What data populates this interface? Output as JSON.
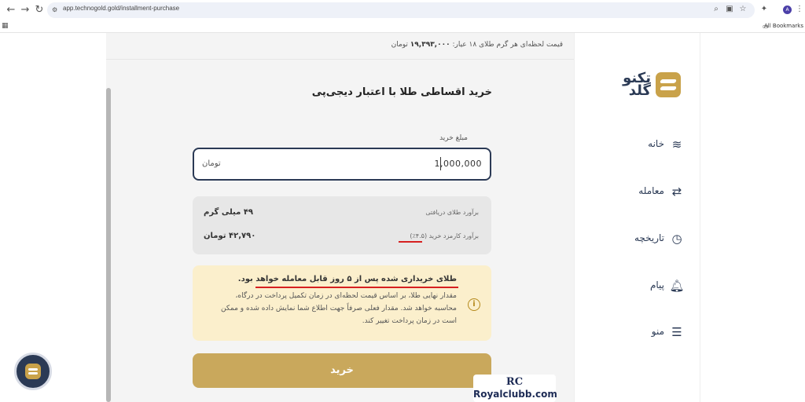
{
  "browser": {
    "url": "app.technogold.gold/installment-purchase",
    "bookmarks_label": "All Bookmarks",
    "profile_initial": "A"
  },
  "header": {
    "price_label": "قیمت لحظه‌ای هر گرم طلای ۱۸ عیار:",
    "price_value": "۱۹,۳۹۳,۰۰۰",
    "price_unit": "تومان"
  },
  "brand": {
    "logo_line1": "تکنو",
    "logo_line2": "گلد"
  },
  "sidebar": {
    "items": [
      {
        "label": "خانه",
        "icon": "home-icon"
      },
      {
        "label": "معامله",
        "icon": "trade-icon"
      },
      {
        "label": "تاریخچه",
        "icon": "history-icon"
      },
      {
        "label": "پیام",
        "icon": "bell-icon"
      },
      {
        "label": "منو",
        "icon": "menu-icon"
      }
    ]
  },
  "main": {
    "title": "خرید اقساطی طلا با اعتبار دیجی‌پی",
    "amount_label": "مبلغ خرید",
    "amount_value": "1,000,000",
    "amount_unit": "تومان",
    "estimate": {
      "gold_label": "برآورد طلای دریافتی",
      "gold_value": "۴۹ میلی گرم",
      "fee_label": "برآورد کارمزد خرید (۴.۵٪)",
      "fee_value": "۴۲,۷۹۰ تومان"
    },
    "notice": {
      "headline": "طلای خریداری شده پس از ۵ روز قابل معامله خواهد بود.",
      "body": "مقدار نهایی طلا، بر اساس قیمت لحظه‌ای در زمان تکمیل پرداخت در درگاه، محاسبه خواهد شد. مقدار فعلی صرفاً جهت اطلاع شما نمایش داده شده و ممکن است در زمان پرداخت تغییر کند."
    },
    "buy_label": "خرید"
  },
  "watermark": {
    "mark": "RC",
    "text": "Royalclubb.com"
  },
  "colors": {
    "brand_navy": "#2b3a55",
    "gold": "#c9a24a",
    "button_gold": "#c9a85c",
    "notice_bg": "#fbefcc",
    "highlight_red": "#d62020"
  }
}
